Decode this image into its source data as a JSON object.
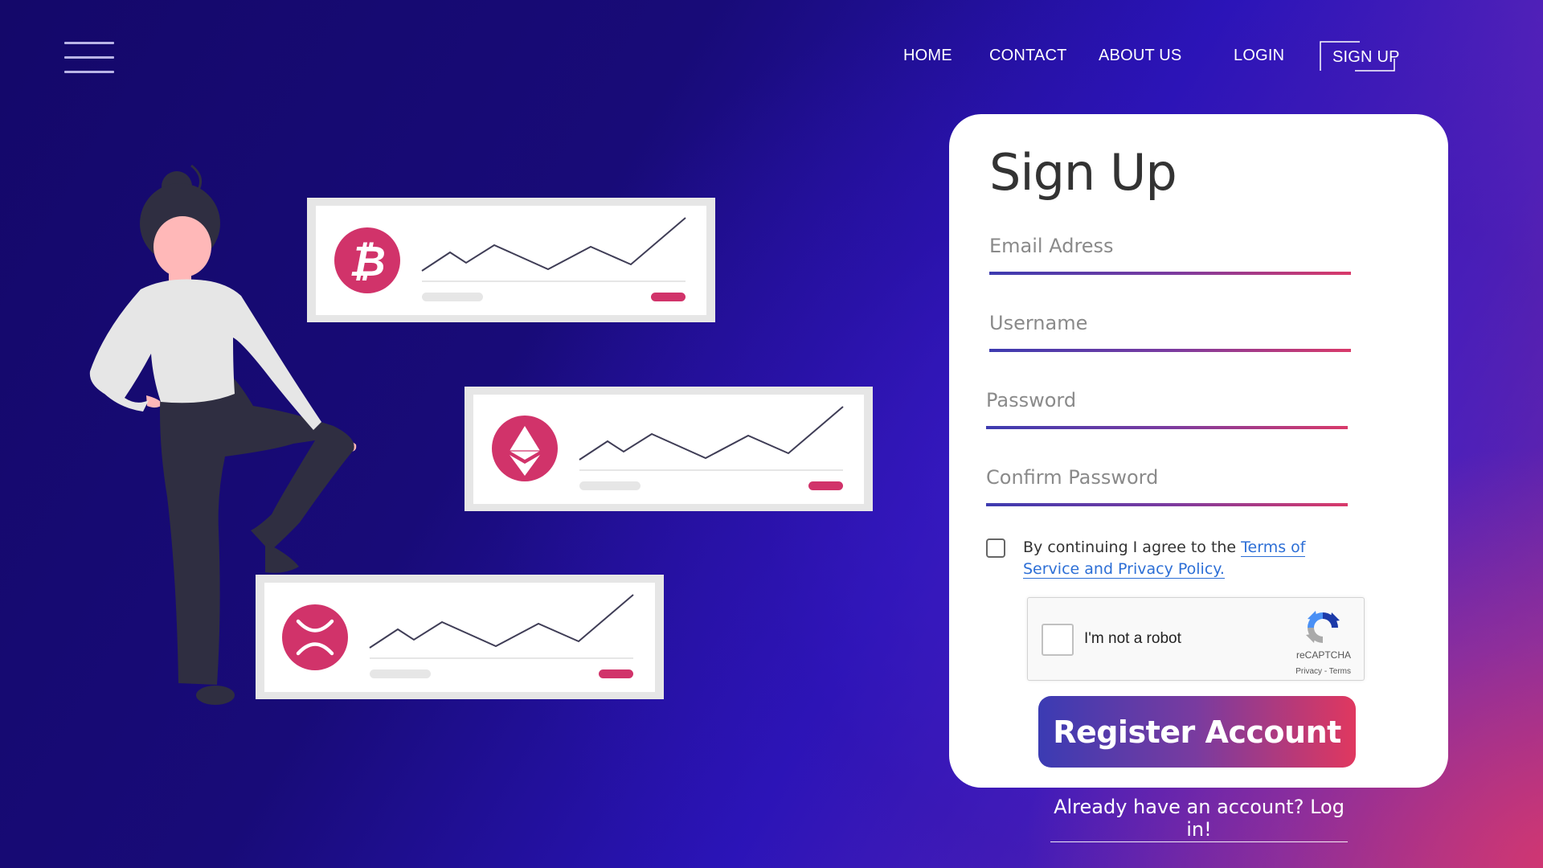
{
  "nav": {
    "home": "HOME",
    "contact": "CONTACT",
    "about": "ABOUT US",
    "login": "LOGIN",
    "signup": "SIGN UP"
  },
  "menu_icon": "hamburger-menu-icon",
  "illustration": {
    "cards": [
      {
        "coin_icon": "bitcoin-icon",
        "accent": "#d1336a"
      },
      {
        "coin_icon": "ethereum-icon",
        "accent": "#d1336a"
      },
      {
        "coin_icon": "xrp-icon",
        "accent": "#d1336a"
      }
    ]
  },
  "form": {
    "title": "Sign Up",
    "email_placeholder": "Email Adress",
    "username_placeholder": "Username",
    "password_placeholder": "Password",
    "confirm_placeholder": "Confirm Password",
    "agree_prefix": "By continuing I agree to the ",
    "agree_link": "Terms of Service and Privacy Policy.",
    "recaptcha_label": "I'm not a robot",
    "recaptcha_brand": "reCAPTCHA",
    "recaptcha_privacy": "Privacy",
    "recaptcha_sep": " - ",
    "recaptcha_terms": "Terms",
    "register_label": "Register Account"
  },
  "login_prompt": "Already have an account? Log in!",
  "colors": {
    "accent": "#d1336a",
    "gradient_start": "#3b3bb3",
    "gradient_end": "#e0385f",
    "link": "#2d6fd6",
    "background_dark": "#14086a"
  }
}
